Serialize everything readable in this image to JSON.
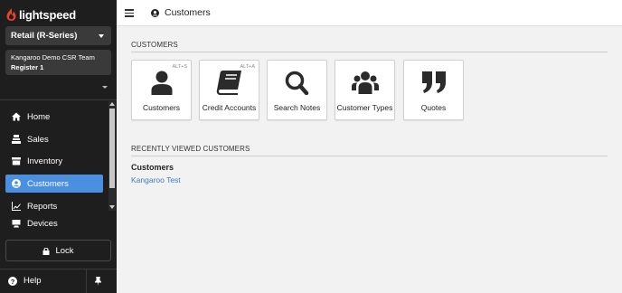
{
  "sidebar": {
    "logo_text": "lightspeed",
    "store": "Retail (R-Series)",
    "team": "Kangaroo Demo CSR Team",
    "register": "Register 1",
    "items": [
      {
        "label": "Home",
        "icon": "home-icon"
      },
      {
        "label": "Sales",
        "icon": "sales-icon"
      },
      {
        "label": "Inventory",
        "icon": "inventory-icon"
      },
      {
        "label": "Customers",
        "icon": "customer-icon",
        "active": true
      },
      {
        "label": "Reports",
        "icon": "reports-icon"
      },
      {
        "label": "Devices",
        "icon": "devices-icon"
      }
    ],
    "lock_label": "Lock",
    "help_label": "Help"
  },
  "header": {
    "title": "Customers"
  },
  "main": {
    "section_title": "CUSTOMERS",
    "tiles": [
      {
        "label": "Customers",
        "shortcut": "ALT+S",
        "icon": "user-icon"
      },
      {
        "label": "Credit Accounts",
        "shortcut": "ALT+A",
        "icon": "book-icon"
      },
      {
        "label": "Search Notes",
        "shortcut": "",
        "icon": "search-icon"
      },
      {
        "label": "Customer Types",
        "shortcut": "",
        "icon": "users-group-icon"
      },
      {
        "label": "Quotes",
        "shortcut": "",
        "icon": "quote-icon"
      }
    ],
    "recent_title": "RECENTLY VIEWED CUSTOMERS",
    "recent_heading": "Customers",
    "recent_items": [
      "Kangaroo Test"
    ]
  },
  "colors": {
    "sidebar_bg": "#1e1e1e",
    "active": "#4a8fe0",
    "link": "#3b7bc9",
    "logo_flame": "#e8412c"
  }
}
